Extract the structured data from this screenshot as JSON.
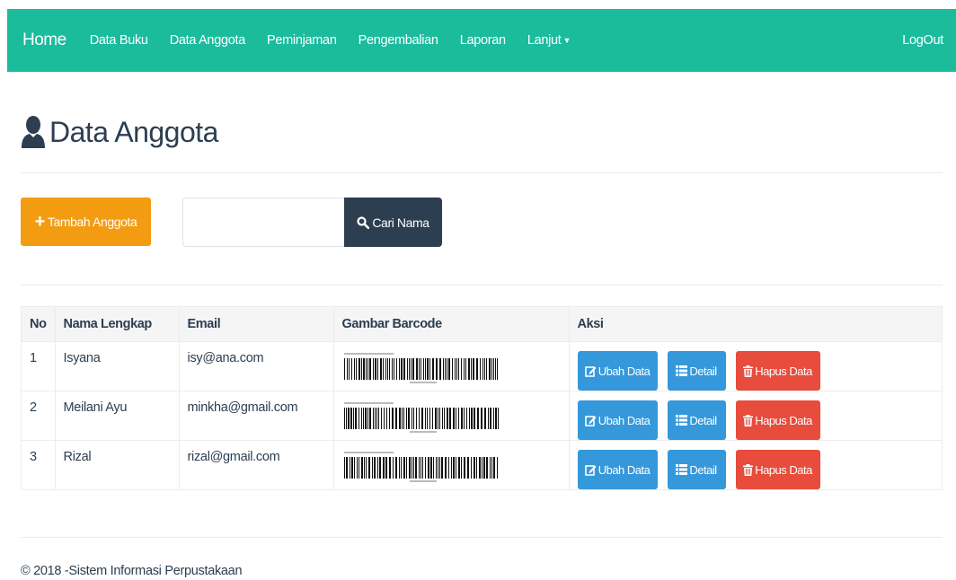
{
  "navbar": {
    "brand": "Home",
    "items": [
      {
        "label": "Data Buku"
      },
      {
        "label": "Data Anggota"
      },
      {
        "label": "Peminjaman"
      },
      {
        "label": "Pengembalian"
      },
      {
        "label": "Laporan"
      },
      {
        "label": "Lanjut"
      }
    ],
    "logout": "LogOut",
    "color": "#1abc9c"
  },
  "header": {
    "title": "Data Anggota",
    "icon": "user-icon"
  },
  "actions": {
    "add_label": "Tambah Anggota",
    "add_icon": "plus-icon",
    "search_value": "",
    "search_button": "Cari Nama",
    "search_icon": "search-icon"
  },
  "table": {
    "columns": [
      "No",
      "Nama Lengkap",
      "Email",
      "Gambar Barcode",
      "Aksi"
    ],
    "rows": [
      {
        "no": "1",
        "name": "Isyana",
        "email": "isy@ana.com"
      },
      {
        "no": "2",
        "name": "Meilani Ayu",
        "email": "minkha@gmail.com"
      },
      {
        "no": "3",
        "name": "Rizal",
        "email": "rizal@gmail.com"
      }
    ],
    "row_actions": {
      "edit": "Ubah Data",
      "detail": "Detail",
      "delete": "Hapus Data"
    }
  },
  "footer": {
    "text": "© 2018 -Sistem Informasi Perpustakaan"
  },
  "colors": {
    "primary": "#3498db",
    "warning": "#f39c12",
    "danger": "#e74c3c",
    "dark": "#2c3e50"
  }
}
